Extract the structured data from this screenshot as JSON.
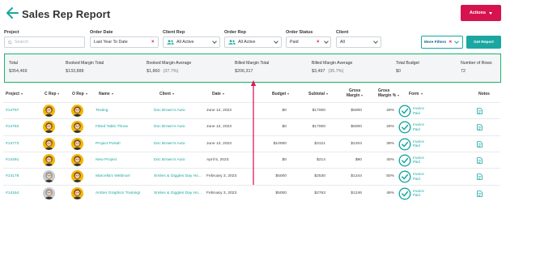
{
  "header": {
    "title": "Sales Rep Report",
    "actions_label": "Actions"
  },
  "filters": {
    "project": {
      "label": "Project",
      "placeholder": "Search"
    },
    "order_date": {
      "label": "Order Date",
      "value": "Last Year To Date"
    },
    "client_rep": {
      "label": "Client Rep",
      "value": "All Active"
    },
    "order_rep": {
      "label": "Order Rep",
      "value": "All Active"
    },
    "order_status": {
      "label": "Order Status",
      "value": "Paid"
    },
    "client": {
      "label": "Client",
      "value": "All"
    },
    "more_filters_label": "More Filters",
    "get_report_label": "Get Report"
  },
  "summary": {
    "total": {
      "label": "Total",
      "value": "$354,469"
    },
    "booked_margin_total": {
      "label": "Booked Margin Total",
      "value": "$133,888"
    },
    "booked_margin_average": {
      "label": "Booked Margin Average",
      "value": "$1,860",
      "pct": "(37.7%)"
    },
    "billed_margin_total": {
      "label": "Billed Margin Total",
      "value": "$206,317"
    },
    "billed_margin_average": {
      "label": "Billed Margin Average",
      "value": "$3,497",
      "pct": "(35.7%)"
    },
    "total_budget": {
      "label": "Total Budget",
      "value": "$0"
    },
    "number_of_rows": {
      "label": "Number of Rows",
      "value": "72"
    }
  },
  "table": {
    "columns": {
      "project": "Project",
      "c_rep": "C Rep",
      "o_rep": "O Rep",
      "name": "Name",
      "client": "Client",
      "date": "Date",
      "budget": "Budget",
      "subtotal": "Subtotal",
      "gross_margin_1": "Gross",
      "gross_margin_2": "Margin",
      "gross_margin_pct_1": "Gross",
      "gross_margin_pct_2": "Margin %",
      "form": "Form",
      "notes": "Notes"
    },
    "rows": [
      {
        "project": "#14797",
        "name": "Testing",
        "client": "Doc Brown's Auto",
        "date": "June 12, 2023",
        "budget": "$0",
        "subtotal": "$17000",
        "gross_margin": "$5000",
        "gross_margin_pct": "29%",
        "form_1": "Invoice",
        "form_2": "Paid",
        "c_avatar": "yellow",
        "o_avatar": "yellow"
      },
      {
        "project": "#14783",
        "name": "Fitted Table Throw",
        "client": "Doc Brown's Auto",
        "date": "June 12, 2023",
        "budget": "$0",
        "subtotal": "$17000",
        "gross_margin": "$5000",
        "gross_margin_pct": "29%",
        "form_1": "Invoice",
        "form_2": "Paid",
        "c_avatar": "yellow",
        "o_avatar": "yellow"
      },
      {
        "project": "#14773",
        "name": "Project Portal!",
        "client": "Doc Brown's Auto",
        "date": "June 13, 2023",
        "budget": "$10000",
        "subtotal": "$3121",
        "gross_margin": "$1204",
        "gross_margin_pct": "39%",
        "form_1": "Invoice",
        "form_2": "Paid",
        "c_avatar": "yellow",
        "o_avatar": "yellow"
      },
      {
        "project": "#14491",
        "name": "New Project",
        "client": "Doc Brown's Auto",
        "date": "April 5, 2023",
        "budget": "$0",
        "subtotal": "$214",
        "gross_margin": "$90",
        "gross_margin_pct": "40%",
        "form_1": "Invoice",
        "form_2": "Paid",
        "c_avatar": "yellow",
        "o_avatar": "yellow"
      },
      {
        "project": "#14178",
        "name": "Marcella's Webinar!",
        "client": "Smiles & Giggles Day Ho...",
        "date": "February 3, 2023",
        "budget": "$5000",
        "subtotal": "$2530",
        "gross_margin": "$1244",
        "gross_margin_pct": "50%",
        "form_1": "Invoice",
        "form_2": "Paid",
        "c_avatar": "gray",
        "o_avatar": "yellow"
      },
      {
        "project": "#14164",
        "name": "Amber Graphics Training!",
        "client": "Smiles & Giggles Day Ho...",
        "date": "February 3, 2023",
        "budget": "$5000",
        "subtotal": "$2763",
        "gross_margin": "$1246",
        "gross_margin_pct": "46%",
        "form_1": "Invoice",
        "form_2": "Paid",
        "c_avatar": "gray",
        "o_avatar": "yellow"
      }
    ]
  },
  "colors": {
    "brand_teal": "#1aa7a1",
    "actions_red": "#d6134f",
    "summary_border": "#1ab36c"
  },
  "icons": [
    "back-arrow-icon",
    "people-icon",
    "close-icon",
    "chevron-down-icon",
    "check-circle-icon",
    "document-icon",
    "sort-icon"
  ]
}
